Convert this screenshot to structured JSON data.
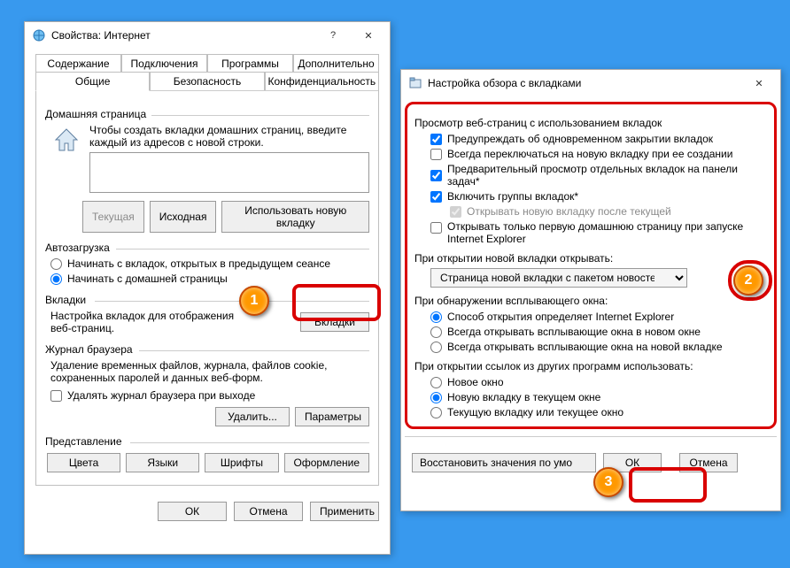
{
  "win1": {
    "title": "Свойства: Интернет",
    "tabs_row1": [
      "Содержание",
      "Подключения",
      "Программы",
      "Дополнительно"
    ],
    "tabs_row2": [
      "Общие",
      "Безопасность",
      "Конфиденциальность"
    ],
    "home": {
      "group": "Домашняя страница",
      "desc1": "Чтобы создать вкладки домашних страниц, введите",
      "desc2": "каждый из адресов с новой строки.",
      "btn_current": "Текущая",
      "btn_default": "Исходная",
      "btn_newtab": "Использовать новую вкладку"
    },
    "startup": {
      "group": "Автозагрузка",
      "opt1": "Начинать с вкладок, открытых в предыдущем сеансе",
      "opt2": "Начинать с домашней страницы"
    },
    "tabs": {
      "group": "Вкладки",
      "desc1": "Настройка вкладок для отображения",
      "desc2": "веб-страниц.",
      "btn": "Вкладки"
    },
    "history": {
      "group": "Журнал браузера",
      "desc1": "Удаление временных файлов, журнала, файлов cookie,",
      "desc2": "сохраненных паролей и данных веб-форм.",
      "chk": "Удалять журнал браузера при выходе",
      "btn_delete": "Удалить...",
      "btn_settings": "Параметры"
    },
    "appearance": {
      "group": "Представление",
      "btn_colors": "Цвета",
      "btn_lang": "Языки",
      "btn_fonts": "Шрифты",
      "btn_access": "Оформление"
    },
    "footer": {
      "ok": "ОК",
      "cancel": "Отмена",
      "apply": "Применить"
    }
  },
  "win2": {
    "title": "Настройка обзора с вкладками",
    "sec1_label": "Просмотр веб-страниц с использованием вкладок",
    "chk_warn": "Предупреждать об одновременном закрытии вкладок",
    "chk_switch": "Всегда переключаться на новую вкладку при ее создании",
    "chk_preview": "Предварительный просмотр отдельных вкладок на панели задач*",
    "chk_groups": "Включить группы вкладок*",
    "chk_opennext": "Открывать новую вкладку после текущей",
    "chk_firsthome1": "Открывать только первую домашнюю страницу при запуске",
    "chk_firsthome2": "Internet Explorer",
    "sec2_label": "При открытии новой вкладки открывать:",
    "dropdown": "Страница новой вкладки с пакетом новостей",
    "sec3_label": "При обнаружении всплывающего окна:",
    "r3a": "Способ открытия определяет Internet Explorer",
    "r3b": "Всегда открывать всплывающие окна в новом окне",
    "r3c": "Всегда открывать всплывающие окна на новой вкладке",
    "sec4_label": "При открытии ссылок из других программ использовать:",
    "r4a": "Новое окно",
    "r4b": "Новую вкладку в текущем окне",
    "r4c": "Текущую вкладку или текущее окно",
    "btn_restore": "Восстановить значения по умо",
    "btn_ok": "ОК",
    "btn_cancel": "Отмена"
  },
  "callouts": {
    "c1": "1",
    "c2": "2",
    "c3": "3"
  }
}
